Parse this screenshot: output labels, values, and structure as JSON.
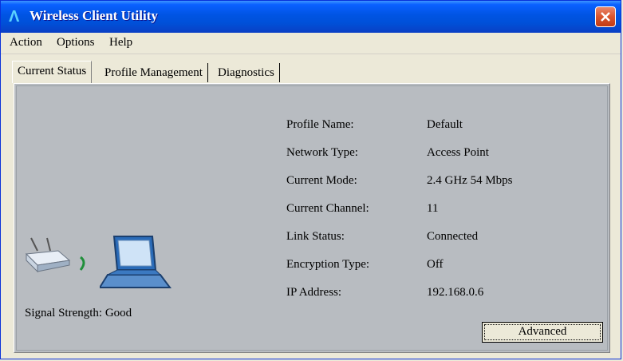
{
  "window": {
    "title": "Wireless Client Utility"
  },
  "menu": {
    "action": "Action",
    "options": "Options",
    "help": "Help"
  },
  "tabs": [
    "Current Status",
    "Profile Management",
    "Diagnostics"
  ],
  "status": {
    "rows": [
      {
        "label": "Profile Name:",
        "value": "Default"
      },
      {
        "label": "Network Type:",
        "value": "Access Point"
      },
      {
        "label": "Current Mode:",
        "value": "2.4 GHz 54 Mbps"
      },
      {
        "label": "Current Channel:",
        "value": "11"
      },
      {
        "label": "Link Status:",
        "value": "Connected"
      },
      {
        "label": "Encryption Type:",
        "value": "Off"
      },
      {
        "label": "IP Address:",
        "value": "192.168.0.6"
      }
    ],
    "signal_label": "Signal Strength:",
    "signal_value": "Good",
    "advanced_button": "Advanced"
  },
  "icons": {
    "app": "antenna-logo-icon",
    "close": "close-icon",
    "router": "router-icon",
    "laptop": "laptop-icon",
    "signal": "signal-wave-icon"
  },
  "colors": {
    "titlebar": "#0054e3",
    "close": "#d9552e",
    "panel": "#b8bcc1",
    "signal_wave": "#1f8f3a"
  }
}
